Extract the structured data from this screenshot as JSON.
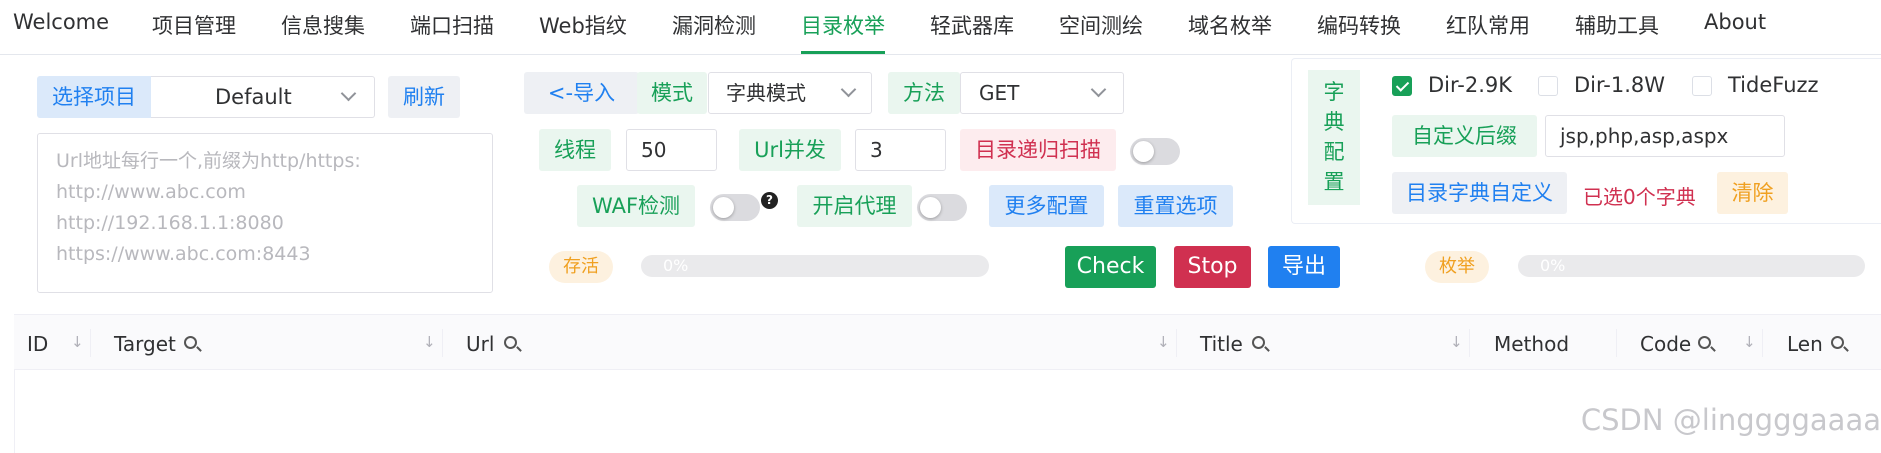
{
  "nav": {
    "items": [
      "Welcome",
      "项目管理",
      "信息搜集",
      "端口扫描",
      "Web指纹",
      "漏洞检测",
      "目录枚举",
      "轻武器库",
      "空间测绘",
      "域名枚举",
      "编码转换",
      "红队常用",
      "辅助工具",
      "About"
    ],
    "active": "目录枚举"
  },
  "project": {
    "label": "选择项目",
    "selected": "Default",
    "refresh": "刷新"
  },
  "url_input": {
    "placeholder_lines": [
      "Url地址每行一个,前缀为http/https:",
      "http://www.abc.com",
      "http://192.168.1.1:8080",
      "https://www.abc.com:8443"
    ]
  },
  "controls": {
    "import": "<-导入",
    "mode_label": "模式",
    "mode_value": "字典模式",
    "method_label": "方法",
    "method_value": "GET",
    "threads_label": "线程",
    "threads_value": "50",
    "concurrency_label": "Url并发",
    "concurrency_value": "3",
    "recursive_label": "目录递归扫描",
    "waf_label": "WAF检测",
    "help_icon": "?",
    "proxy_label": "开启代理",
    "more_config": "更多配置",
    "reset": "重置选项"
  },
  "progress": {
    "alive_label": "存活",
    "alive_value": "0%",
    "enum_label": "枚举",
    "enum_value": "0%"
  },
  "actions": {
    "check": "Check",
    "stop": "Stop",
    "export": "导出"
  },
  "dict": {
    "title_chars": [
      "字",
      "典",
      "配",
      "置"
    ],
    "options": [
      {
        "label": "Dir-2.9K",
        "checked": true
      },
      {
        "label": "Dir-1.8W",
        "checked": false
      },
      {
        "label": "TideFuzz",
        "checked": false
      }
    ],
    "custom_suffix_label": "自定义后缀",
    "custom_suffix_value": "jsp,php,asp,aspx",
    "custom_dict": "目录字典自定义",
    "selected_count": "已选0个字典",
    "clear": "清除"
  },
  "table": {
    "columns": [
      "ID",
      "Target",
      "Url",
      "Title",
      "Method",
      "Code",
      "Len"
    ]
  },
  "watermark": "CSDN @linggggaaaa",
  "colors": {
    "accent_green": "#18a058",
    "blue": "#2080f0",
    "red": "#d03050",
    "orange": "#f0a020"
  }
}
